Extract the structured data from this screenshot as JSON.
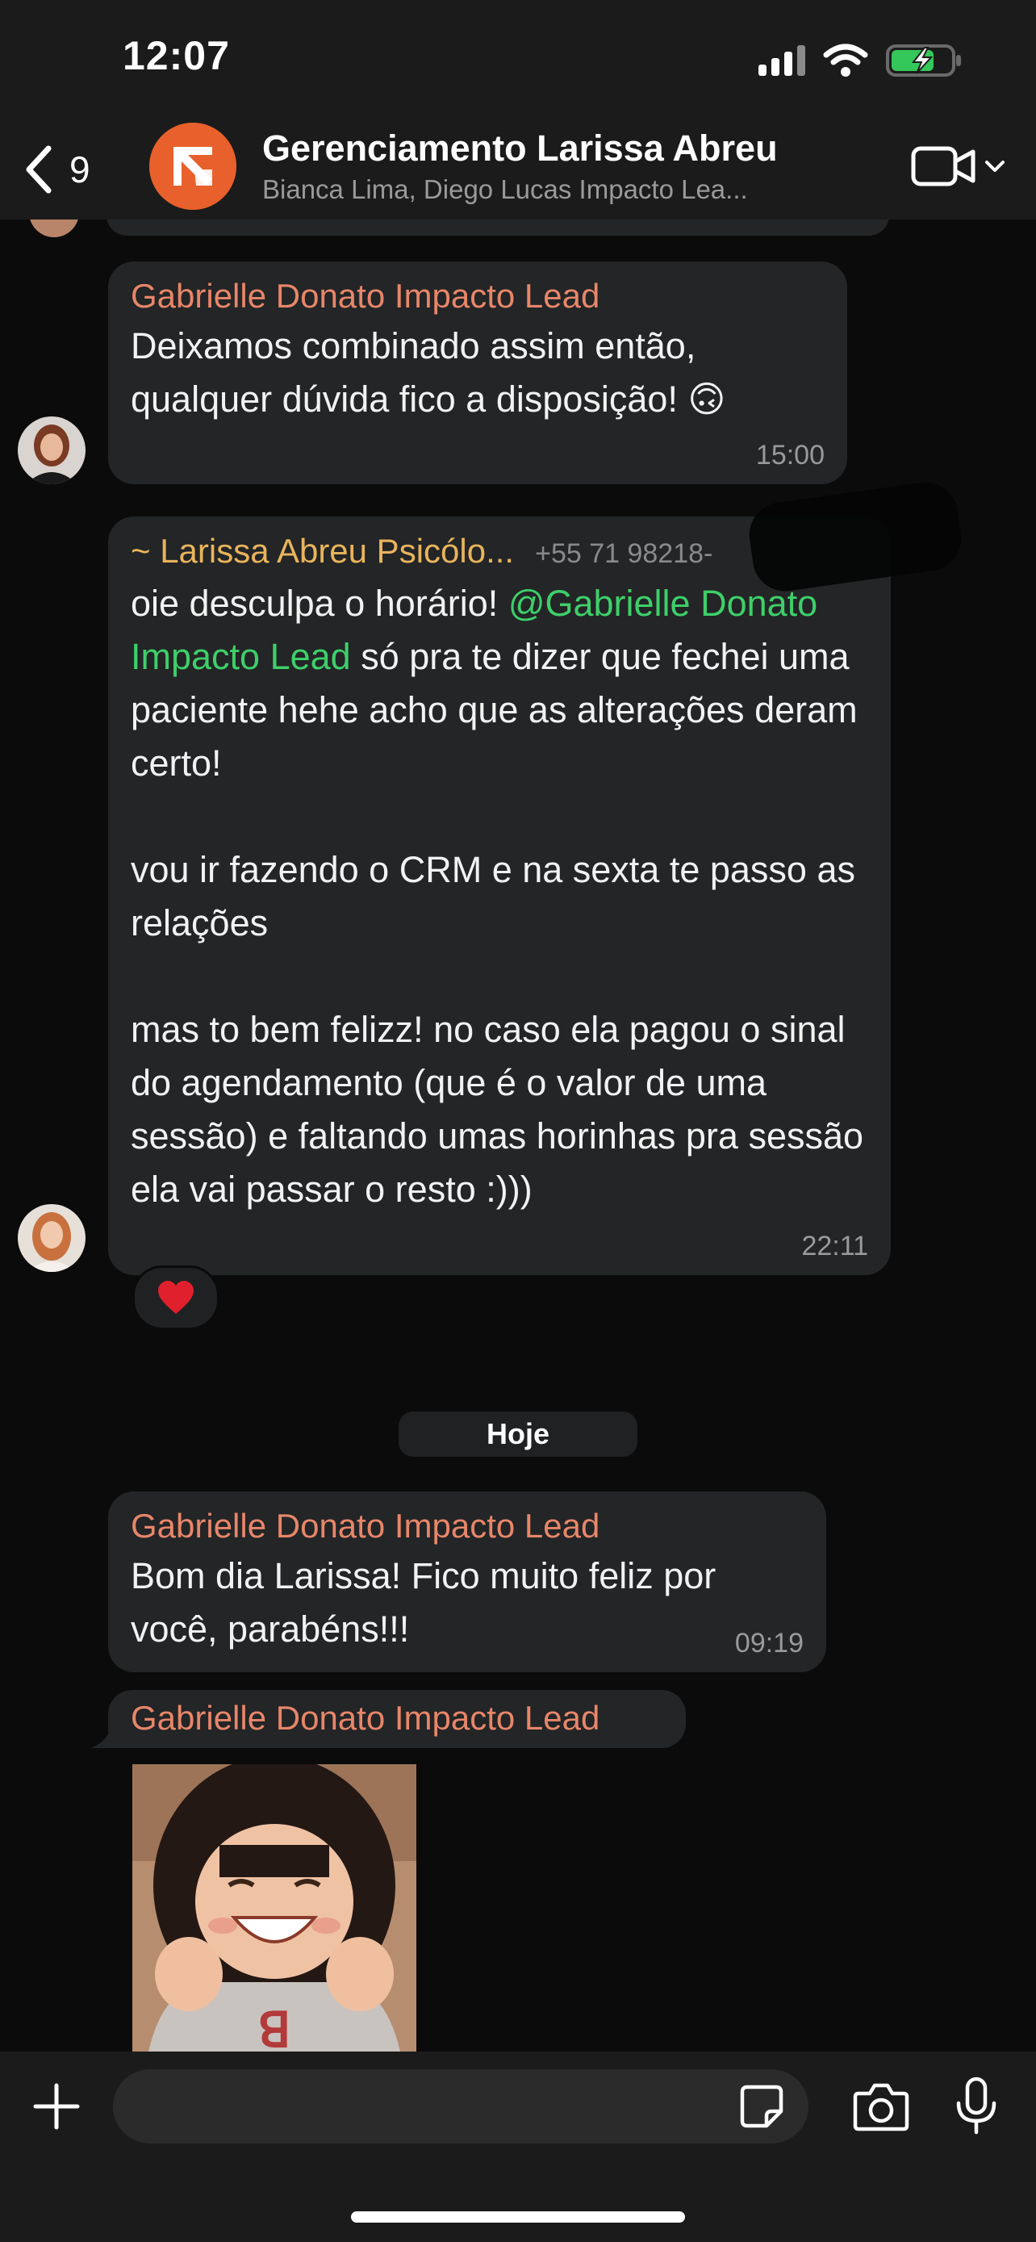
{
  "status_bar": {
    "time": "12:07"
  },
  "header": {
    "back_count": "9",
    "group_name": "Gerenciamento Larissa Abreu",
    "members": "Bianca Lima, Diego Lucas Impacto Lea...",
    "video_icon": "video-camera-icon"
  },
  "messages": [
    {
      "sender": "Gabrielle Donato Impacto Lead",
      "text": "Deixamos combinado assim então,\nqualquer dúvida fico a disposição! 🙃",
      "time": "15:00"
    },
    {
      "sender": "~ Larissa Abreu Psicólo...",
      "phone": "+55 71 98218-",
      "text_before_mention": "oie desculpa o horário! ",
      "mention": "@Gabrielle Donato Impacto Lead",
      "text_after_mention": " só pra te dizer que fechei uma paciente hehe acho que as alterações deram certo!\n\nvou ir fazendo o CRM e na sexta te passo as relações\n\nmas to bem felizz! no caso ela pagou o sinal do agendamento (que é o valor de uma sessão) e faltando umas horinhas pra sessão ela vai passar o resto :)))",
      "time": "22:11",
      "reaction": "❤️"
    },
    {
      "sender": "Gabrielle Donato Impacto Lead",
      "text": "Bom dia Larissa! Fico muito feliz por\nvocê, parabéns!!!",
      "time": "09:19"
    },
    {
      "sender": "Gabrielle Donato Impacto Lead",
      "image": "sticker-girl-excited"
    }
  ],
  "date_divider": "Hoje",
  "colors": {
    "bubble": "#232526",
    "sender_name_gabrielle": "#e8866a",
    "sender_name_larissa": "#e9b45c",
    "mention": "#3ecf6a",
    "background": "#0b0b0b"
  }
}
